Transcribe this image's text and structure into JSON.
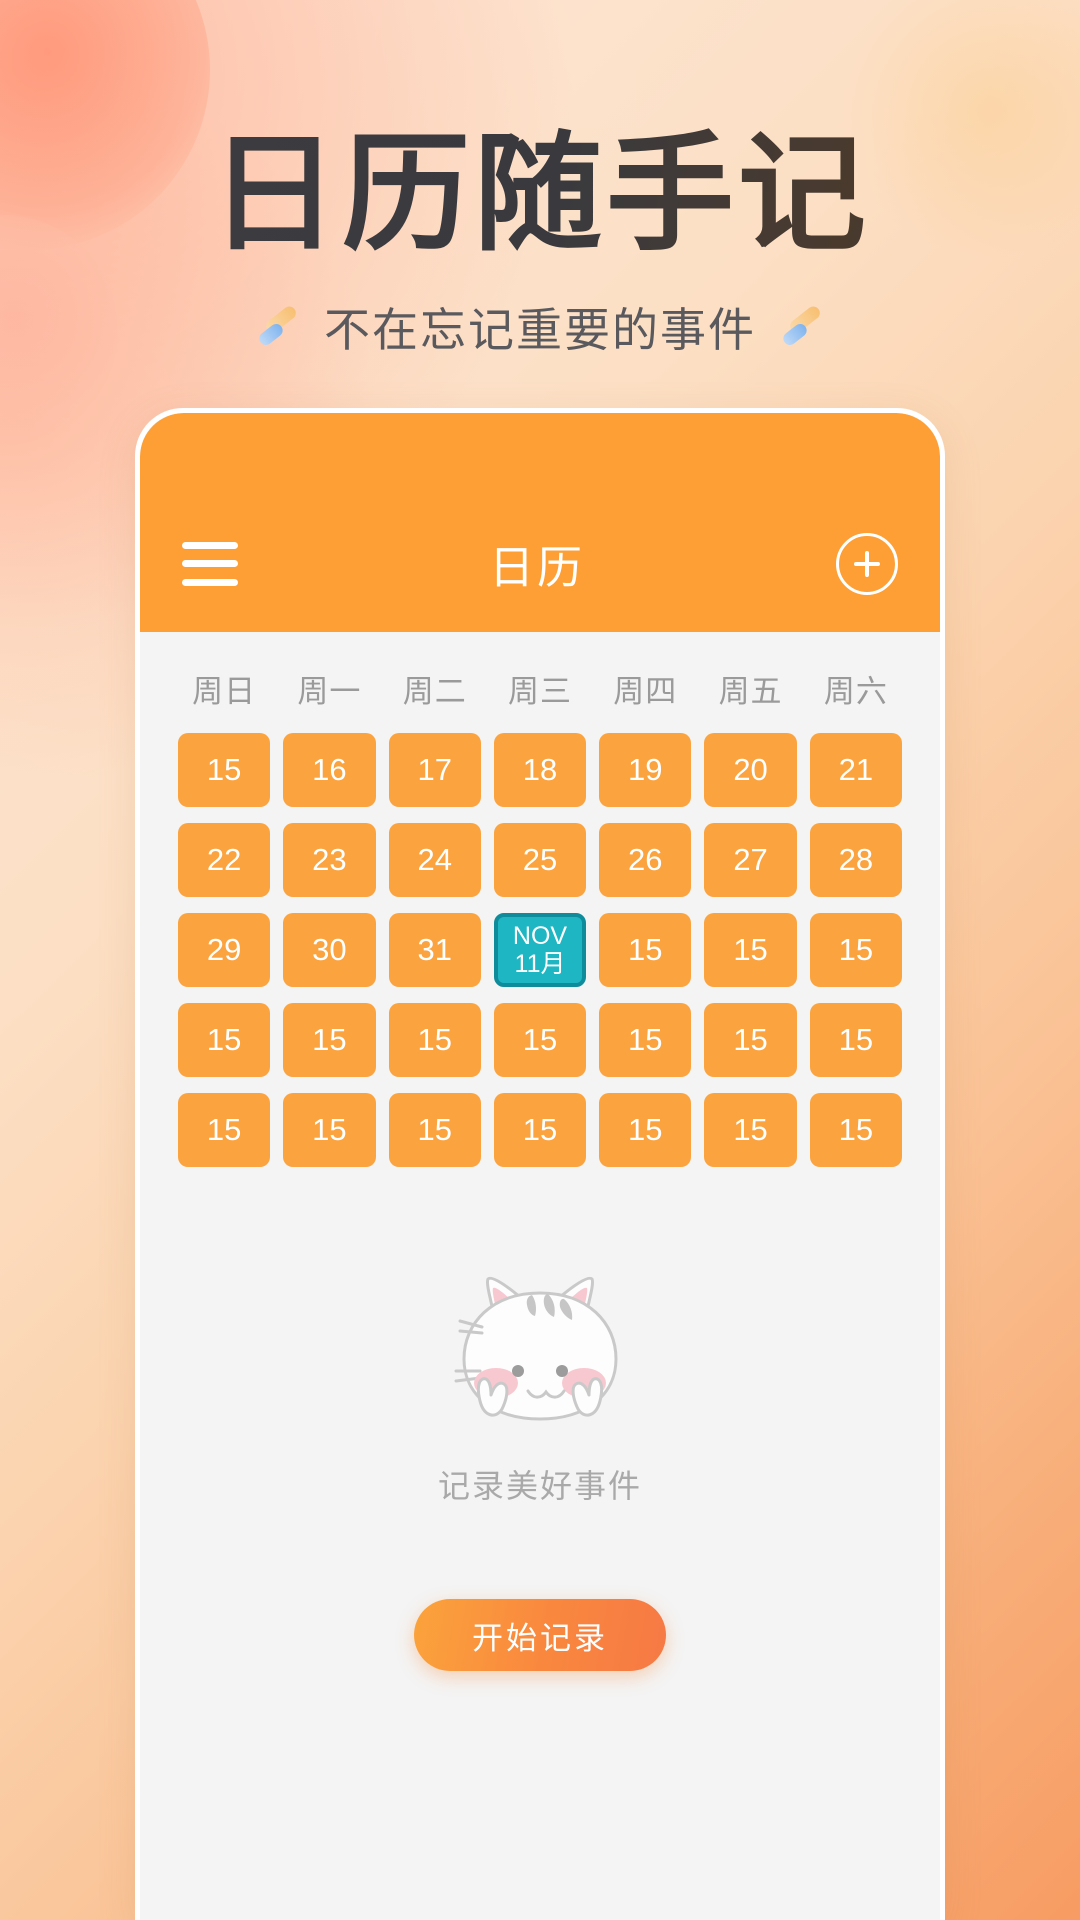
{
  "promo": {
    "title": "日历随手记",
    "subtitle": "不在忘记重要的事件",
    "sparkle_left_icon": "sparkle-icon",
    "sparkle_right_icon": "sparkle-icon"
  },
  "app": {
    "header": {
      "menu_icon": "hamburger-menu-icon",
      "title": "日历",
      "add_icon": "plus-circle-icon"
    },
    "calendar": {
      "weekdays": [
        "周日",
        "周一",
        "周二",
        "周三",
        "周四",
        "周五",
        "周六"
      ],
      "rows": [
        [
          {
            "label": "15",
            "today": false
          },
          {
            "label": "16",
            "today": false
          },
          {
            "label": "17",
            "today": false
          },
          {
            "label": "18",
            "today": false
          },
          {
            "label": "19",
            "today": false
          },
          {
            "label": "20",
            "today": false
          },
          {
            "label": "21",
            "today": false
          }
        ],
        [
          {
            "label": "22",
            "today": false
          },
          {
            "label": "23",
            "today": false
          },
          {
            "label": "24",
            "today": false
          },
          {
            "label": "25",
            "today": false
          },
          {
            "label": "26",
            "today": false
          },
          {
            "label": "27",
            "today": false
          },
          {
            "label": "28",
            "today": false
          }
        ],
        [
          {
            "label": "29",
            "today": false
          },
          {
            "label": "30",
            "today": false
          },
          {
            "label": "31",
            "today": false
          },
          {
            "label": "NOV",
            "label2": "11月",
            "today": true
          },
          {
            "label": "15",
            "today": false
          },
          {
            "label": "15",
            "today": false
          },
          {
            "label": "15",
            "today": false
          }
        ],
        [
          {
            "label": "15",
            "today": false
          },
          {
            "label": "15",
            "today": false
          },
          {
            "label": "15",
            "today": false
          },
          {
            "label": "15",
            "today": false
          },
          {
            "label": "15",
            "today": false
          },
          {
            "label": "15",
            "today": false
          },
          {
            "label": "15",
            "today": false
          }
        ],
        [
          {
            "label": "15",
            "today": false
          },
          {
            "label": "15",
            "today": false
          },
          {
            "label": "15",
            "today": false
          },
          {
            "label": "15",
            "today": false
          },
          {
            "label": "15",
            "today": false
          },
          {
            "label": "15",
            "today": false
          },
          {
            "label": "15",
            "today": false
          }
        ]
      ]
    },
    "empty_state": {
      "illustration_icon": "cat-illustration",
      "text": "记录美好事件"
    },
    "cta": {
      "label": "开始记录"
    }
  },
  "colors": {
    "header_orange": "#FD9F35",
    "day_orange": "#FBA33E",
    "today_teal": "#1FB6C4",
    "today_teal_border": "#0E8C9B",
    "cta_gradient_start": "#FBA33C",
    "cta_gradient_end": "#F67945",
    "page_bg_start": "#FEE7D8",
    "page_bg_end": "#F79C63",
    "card_bg": "#F4F4F4",
    "weekday_gray": "#9A9A9A",
    "empty_text_gray": "#A9A9A9",
    "title_dark": "#3A3A3E"
  }
}
